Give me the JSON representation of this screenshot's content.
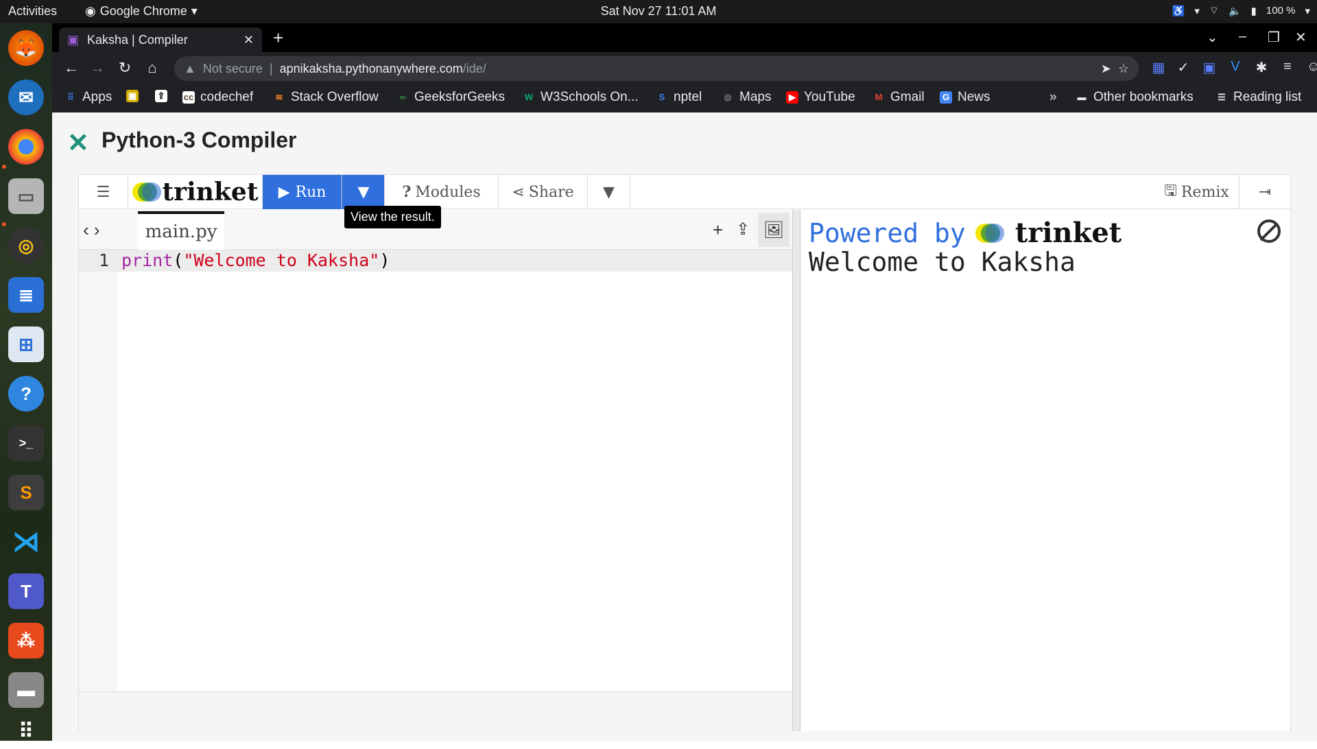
{
  "system": {
    "activities": "Activities",
    "app_name": "Google Chrome",
    "clock": "Sat Nov 27  11:01 AM",
    "battery": "100 %"
  },
  "browser": {
    "tab_title": "Kaksha | Compiler",
    "security_label": "Not secure",
    "url_host": "apnikaksha.pythonanywhere.com",
    "url_path": "/ide/",
    "bookmarks": [
      {
        "label": "Apps",
        "icon": "apps-grid-icon",
        "color": "#4285f4"
      },
      {
        "label": "codechef",
        "icon": "codechef-icon",
        "color": "#8b5a2b"
      },
      {
        "label": "Stack Overflow",
        "icon": "stackoverflow-icon",
        "color": "#f48024"
      },
      {
        "label": "GeeksforGeeks",
        "icon": "gfg-icon",
        "color": "#2f8d46"
      },
      {
        "label": "W3Schools On...",
        "icon": "w3schools-icon",
        "color": "#04aa6d"
      },
      {
        "label": "nptel",
        "icon": "nptel-icon",
        "color": "#3b82f6"
      },
      {
        "label": "Maps",
        "icon": "maps-icon",
        "color": "#666666"
      },
      {
        "label": "YouTube",
        "icon": "youtube-icon",
        "color": "#ff0000"
      },
      {
        "label": "Gmail",
        "icon": "gmail-icon",
        "color": "#ea4335"
      },
      {
        "label": "News",
        "icon": "news-icon",
        "color": "#4285f4"
      }
    ],
    "overflow": "»",
    "other_bookmarks": "Other bookmarks",
    "reading_list": "Reading list"
  },
  "page": {
    "title": "Python-3 Compiler",
    "accent": "#1e8f7c"
  },
  "trinket": {
    "brand": "trinket",
    "run_label": "Run",
    "modules_label": "Modules",
    "share_label": "Share",
    "remix_label": "Remix",
    "tooltip": "View the result.",
    "run_color": "#2f6fde",
    "file_name": "main.py",
    "line_number": "1",
    "code_func": "print",
    "code_open": "(",
    "code_string": "\"Welcome to Kaksha\"",
    "code_close": ")",
    "powered_by": "Powered by",
    "output": "Welcome to Kaksha"
  }
}
